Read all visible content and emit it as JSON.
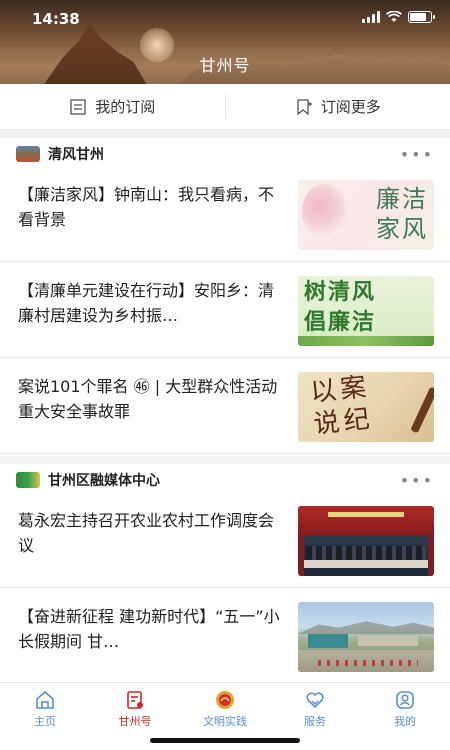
{
  "status_bar": {
    "time": "14:38"
  },
  "header": {
    "title": "甘州号"
  },
  "subscription_bar": {
    "my_subscriptions": "我的订阅",
    "subscribe_more": "订阅更多"
  },
  "sections": [
    {
      "title": "清风甘州",
      "more": "•••",
      "articles": [
        {
          "title": "【廉洁家风】钟南山：我只看病，不看背景",
          "thumb_text": "廉洁\n家风"
        },
        {
          "title": "【清廉单元建设在行动】安阳乡：清廉村居建设为乡村振…",
          "thumb_text": "树清风\n倡廉洁"
        },
        {
          "title": "案说101个罪名 ㊻ | 大型群众性活动重大安全事故罪",
          "thumb_text": "以案\n说纪"
        }
      ]
    },
    {
      "title": "甘州区融媒体中心",
      "more": "•••",
      "articles": [
        {
          "title": "葛永宏主持召开农业农村工作调度会议"
        },
        {
          "title": "【奋进新征程 建功新时代】“五一”小长假期间 甘…"
        }
      ]
    }
  ],
  "tabbar": {
    "items": [
      {
        "label": "主页",
        "icon": "home-icon"
      },
      {
        "label": "甘州号",
        "icon": "document-icon"
      },
      {
        "label": "文明实践",
        "icon": "civilization-emblem-icon"
      },
      {
        "label": "服务",
        "icon": "heart-hands-icon"
      },
      {
        "label": "我的",
        "icon": "user-icon"
      }
    ],
    "active_index": 1,
    "colors": {
      "inactive": "#5a8fd3",
      "active": "#d1272b"
    }
  }
}
